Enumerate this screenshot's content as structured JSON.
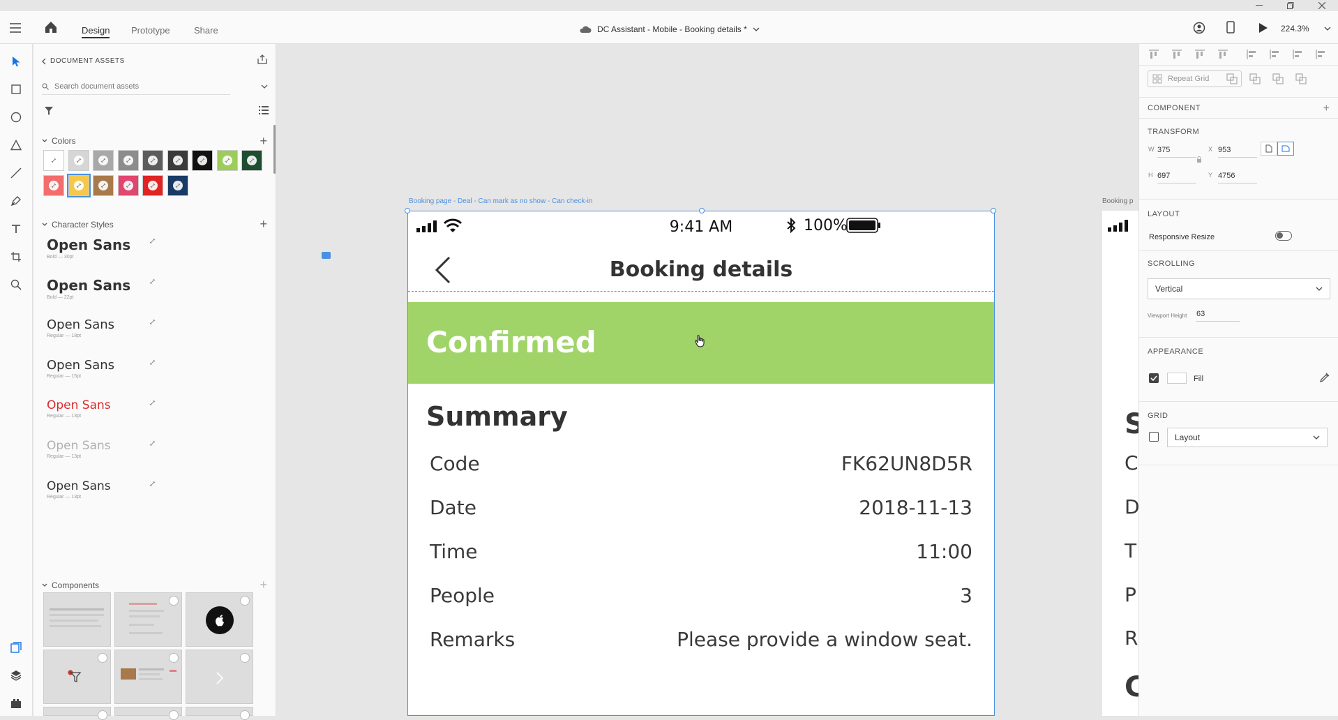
{
  "app": {
    "nav_tabs": [
      "Design",
      "Prototype",
      "Share"
    ],
    "document_title": "DC Assistant - Mobile - Booking details *",
    "zoom": "224.3%"
  },
  "assets": {
    "header": "DOCUMENT ASSETS",
    "search_placeholder": "Search document assets",
    "colors_label": "Colors",
    "colors_row1": [
      "#ffffff",
      "#d6d6d6",
      "#a8a8a8",
      "#8c8c8c",
      "#5c5c5c",
      "#3a3a3a",
      "#111111",
      "#9ccc5a",
      "#1e4d30"
    ],
    "colors_row2": [
      "#f26d6d",
      "#f5c84c",
      "#a8794a",
      "#e0466e",
      "#e02323",
      "#173a66"
    ],
    "char_styles_label": "Character Styles",
    "char_styles": [
      {
        "name": "Open Sans",
        "meta": "Bold — 30pt",
        "weight": "bold",
        "size": "20px",
        "color": "#333333"
      },
      {
        "name": "Open Sans",
        "meta": "Bold — 22pt",
        "weight": "bold",
        "size": "20px",
        "color": "#333333"
      },
      {
        "name": "Open Sans",
        "meta": "Regular — 18pt",
        "weight": "normal",
        "size": "18px",
        "color": "#333333"
      },
      {
        "name": "Open Sans",
        "meta": "Regular — 15pt",
        "weight": "normal",
        "size": "18px",
        "color": "#333333"
      },
      {
        "name": "Open Sans",
        "meta": "Regular — 13pt",
        "weight": "normal",
        "size": "17px",
        "color": "#d92a2a"
      },
      {
        "name": "Open Sans",
        "meta": "Regular — 13pt",
        "weight": "normal",
        "size": "17px",
        "color": "#b0b0b0"
      },
      {
        "name": "Open Sans",
        "meta": "Regular — 13pt",
        "weight": "normal",
        "size": "17px",
        "color": "#333333"
      }
    ],
    "components_label": "Components"
  },
  "canvas": {
    "artboard_label": "Booking page - Deal - Can mark as no show - Can check-in",
    "artboard2_label": "Booking p",
    "status_time": "9:41 AM",
    "battery": "100%",
    "page_title": "Booking details",
    "status_banner": "Confirmed",
    "banner_color": "#a0d468",
    "summary_title": "Summary",
    "rows": [
      {
        "label": "Code",
        "value": "FK62UN8D5R"
      },
      {
        "label": "Date",
        "value": "2018-11-13"
      },
      {
        "label": "Time",
        "value": "11:00"
      },
      {
        "label": "People",
        "value": "3"
      },
      {
        "label": "Remarks",
        "value": "Please provide a window seat."
      }
    ],
    "artboard2_letters": [
      "S",
      "C",
      "D",
      "T",
      "P",
      "R",
      "C"
    ]
  },
  "props": {
    "repeat_grid": "Repeat Grid",
    "component": "COMPONENT",
    "transform": "TRANSFORM",
    "w_label": "W",
    "w": "375",
    "x_label": "X",
    "x": "953",
    "h_label": "H",
    "h": "697",
    "y_label": "Y",
    "y": "4756",
    "layout": "LAYOUT",
    "responsive_resize": "Responsive Resize",
    "scrolling": "SCROLLING",
    "scroll_value": "Vertical",
    "viewport_height_label": "Viewport Height",
    "viewport_height": "63",
    "appearance": "APPEARANCE",
    "fill_label": "Fill",
    "grid": "GRID",
    "grid_value": "Layout"
  }
}
